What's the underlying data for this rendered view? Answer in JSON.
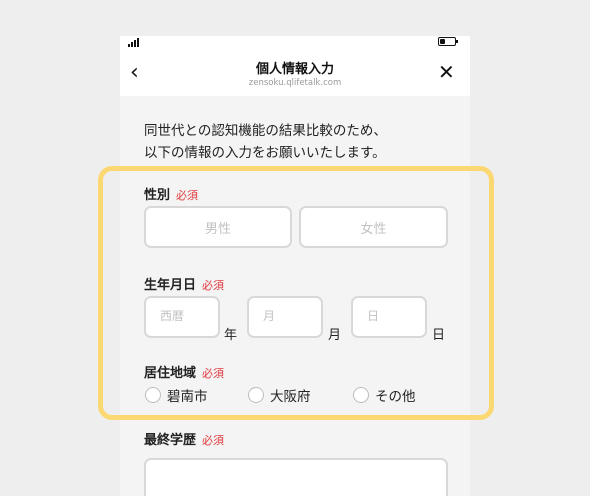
{
  "nav": {
    "title": "個人情報入力",
    "subtitle": "zensoku.qlifetalk.com",
    "back": "‹",
    "close": "✕"
  },
  "intro": {
    "line1": "同世代との認知機能の結果比較のため、",
    "line2": "以下の情報の入力をお願いいたします。"
  },
  "required_label": "必須",
  "gender": {
    "label": "性別",
    "options": [
      "男性",
      "女性"
    ]
  },
  "birthdate": {
    "label": "生年月日",
    "year_placeholder": "西暦",
    "year_unit": "年",
    "month_placeholder": "月",
    "month_unit": "月",
    "day_placeholder": "日",
    "day_unit": "日"
  },
  "residence": {
    "label": "居住地域",
    "options": [
      "碧南市",
      "大阪府",
      "その他"
    ]
  },
  "education": {
    "label": "最終学歴"
  },
  "colors": {
    "required": "#e0393e",
    "highlight": "#fbd872",
    "border": "#d8d8d8"
  }
}
